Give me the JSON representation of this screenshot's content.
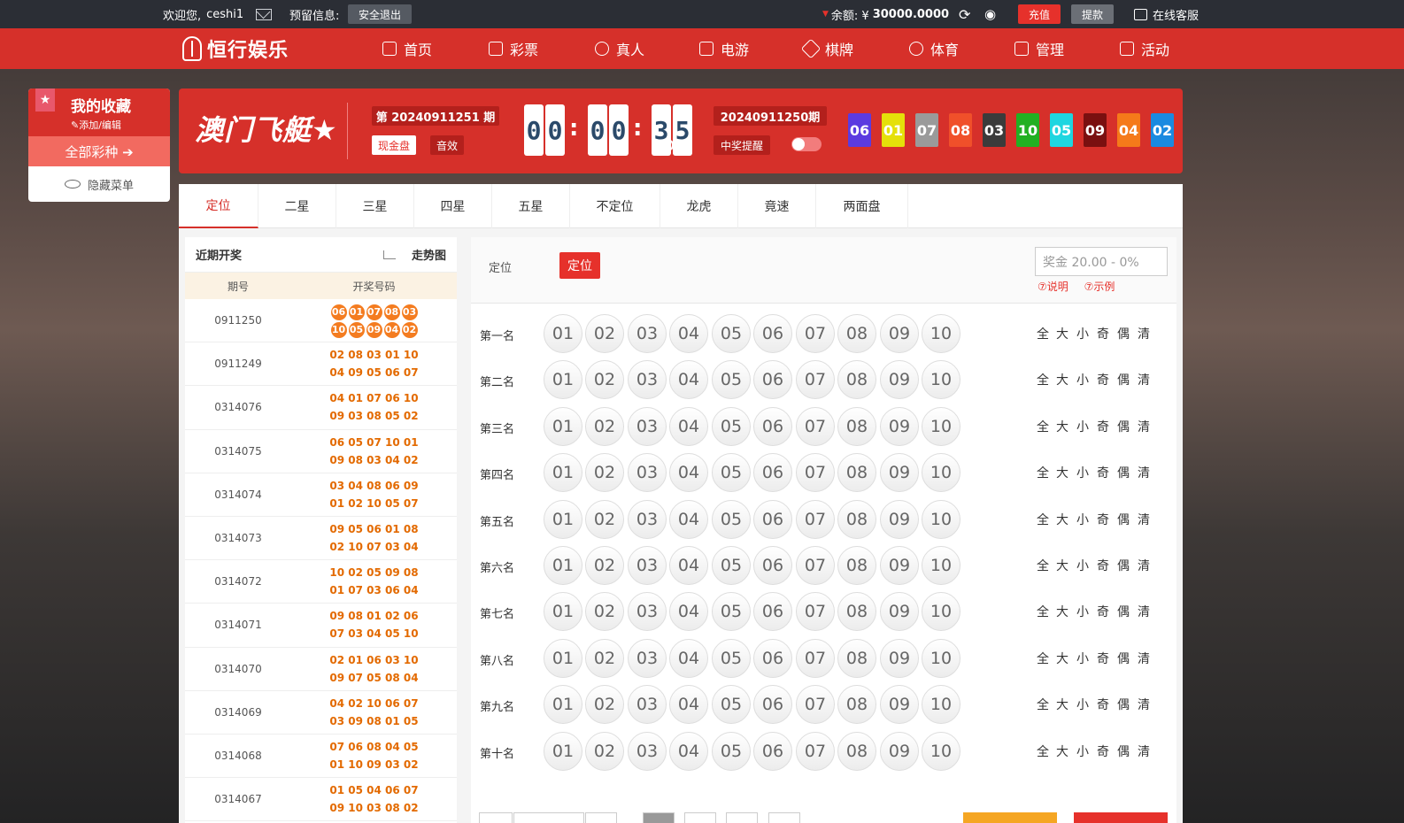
{
  "topbar": {
    "welcome": "欢迎您,",
    "username": "ceshi1",
    "reserved_info": "预留信息:",
    "logout": "安全退出",
    "balance_label": "余额: ¥",
    "balance": "30000.0000",
    "recharge": "充值",
    "withdraw": "提款",
    "service": "在线客服"
  },
  "brand": {
    "name": "恒行娱乐"
  },
  "nav": [
    "首页",
    "彩票",
    "真人",
    "电游",
    "棋牌",
    "体育",
    "管理",
    "活动"
  ],
  "favorites": {
    "title": "我的收藏",
    "edit": "✎添加/编辑",
    "all": "全部彩种 ➔",
    "hide": "隐藏菜单"
  },
  "game": {
    "title": "澳门飞艇",
    "current_issue": "第 20240911251 期",
    "cash_mode": "现金盘",
    "sound": "音效",
    "countdown": [
      "0",
      "0",
      "0",
      "0",
      "3",
      "5"
    ],
    "last_issue": "20240911250期",
    "win_alert": "中奖提醒",
    "result_balls": [
      {
        "n": "06",
        "c": "#5b3be0"
      },
      {
        "n": "01",
        "c": "#e5e00a"
      },
      {
        "n": "07",
        "c": "#9a9a9a"
      },
      {
        "n": "08",
        "c": "#f0502a"
      },
      {
        "n": "03",
        "c": "#3b3b3b"
      },
      {
        "n": "10",
        "c": "#22b022"
      },
      {
        "n": "05",
        "c": "#1fd6e0"
      },
      {
        "n": "09",
        "c": "#7a1010"
      },
      {
        "n": "04",
        "c": "#f57a1a"
      },
      {
        "n": "02",
        "c": "#1a8ae0"
      }
    ]
  },
  "tabs": [
    "定位",
    "二星",
    "三星",
    "四星",
    "五星",
    "不定位",
    "龙虎",
    "竟速",
    "两面盘"
  ],
  "history": {
    "title": "近期开奖",
    "trend": "走势图",
    "col_issue": "期号",
    "col_numbers": "开奖号码",
    "latest": {
      "issue": "0911250",
      "line1": [
        "06",
        "01",
        "07",
        "08",
        "03"
      ],
      "line2": [
        "10",
        "05",
        "09",
        "04",
        "02"
      ]
    },
    "rows": [
      {
        "issue": "0911249",
        "line1": "02 08 03 01 10",
        "line2": "04 09 05 06 07"
      },
      {
        "issue": "0314076",
        "line1": "04 01 07 06 10",
        "line2": "09 03 08 05 02"
      },
      {
        "issue": "0314075",
        "line1": "06 05 07 10 01",
        "line2": "09 08 03 04 02"
      },
      {
        "issue": "0314074",
        "line1": "03 04 08 06 09",
        "line2": "01 02 10 05 07"
      },
      {
        "issue": "0314073",
        "line1": "09 05 06 01 08",
        "line2": "02 10 07 03 04"
      },
      {
        "issue": "0314072",
        "line1": "10 02 05 09 08",
        "line2": "01 07 03 06 04"
      },
      {
        "issue": "0314071",
        "line1": "09 08 01 02 06",
        "line2": "07 03 04 05 10"
      },
      {
        "issue": "0314070",
        "line1": "02 01 06 03 10",
        "line2": "09 07 05 08 04"
      },
      {
        "issue": "0314069",
        "line1": "04 02 10 06 07",
        "line2": "03 09 08 01 05"
      },
      {
        "issue": "0314068",
        "line1": "07 06 08 04 05",
        "line2": "01 10 09 03 02"
      },
      {
        "issue": "0314067",
        "line1": "01 05 04 06 07",
        "line2": "09 10 03 08 02"
      }
    ]
  },
  "selection": {
    "label": "定位",
    "mode_button": "定位",
    "prize": "奖金 20.00 - 0%",
    "explain": "⑦说明",
    "example": "⑦示例",
    "positions": [
      "第一名",
      "第二名",
      "第三名",
      "第四名",
      "第五名",
      "第六名",
      "第七名",
      "第八名",
      "第九名",
      "第十名"
    ],
    "numbers": [
      "01",
      "02",
      "03",
      "04",
      "05",
      "06",
      "07",
      "08",
      "09",
      "10"
    ],
    "quick": [
      "全",
      "大",
      "小",
      "奇",
      "偶",
      "清"
    ]
  }
}
